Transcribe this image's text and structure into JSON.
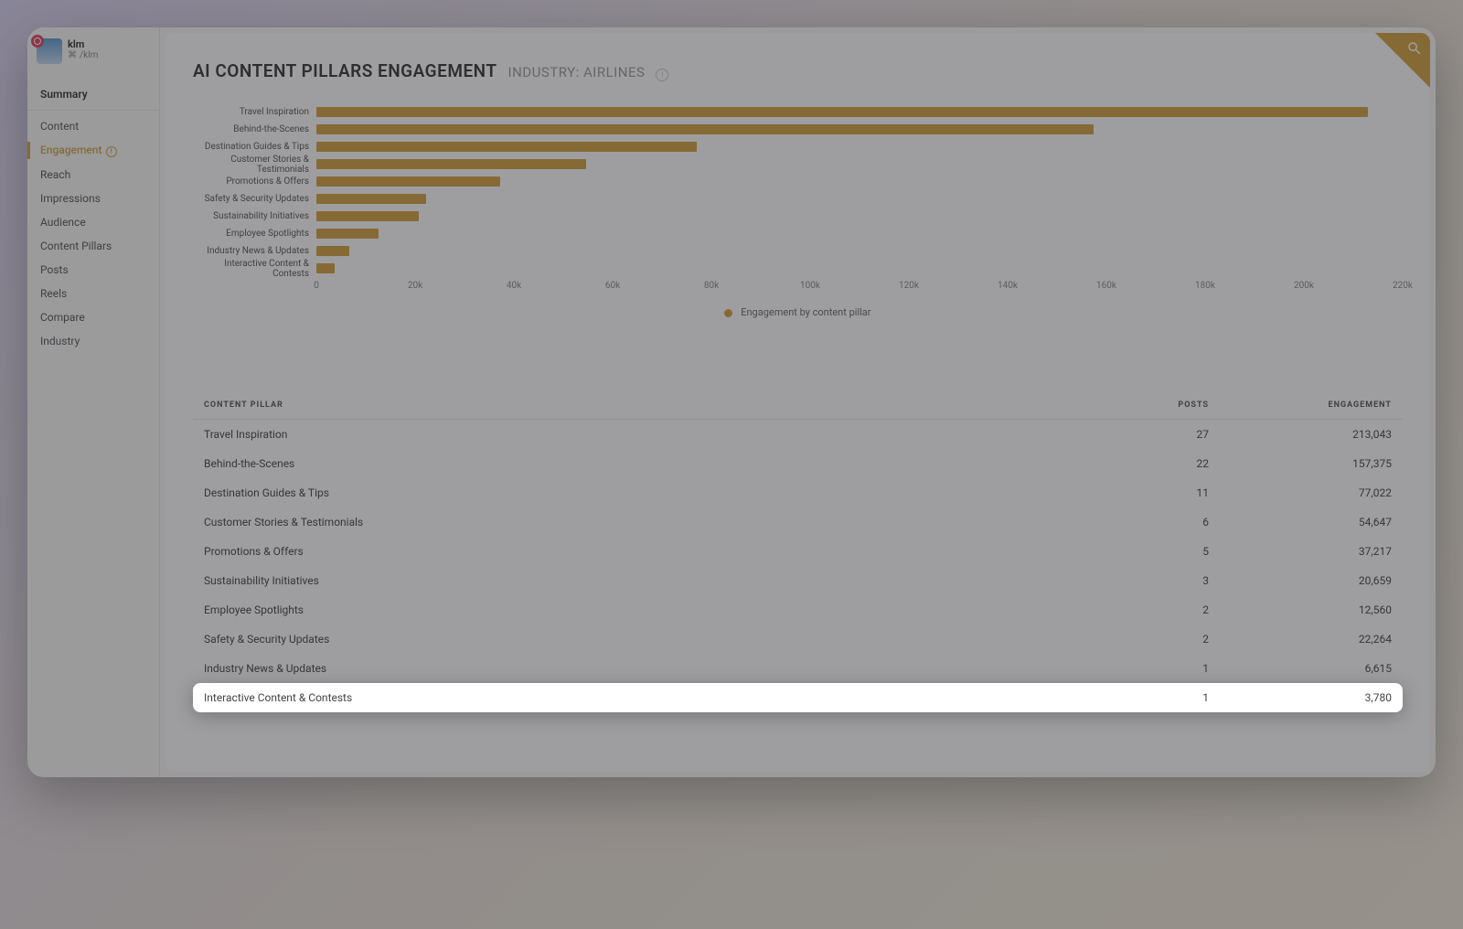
{
  "profile": {
    "name": "klm",
    "handle": "/klm"
  },
  "sidebar": {
    "summary": "Summary",
    "items": [
      {
        "label": "Content"
      },
      {
        "label": "Engagement",
        "active": true,
        "info": true
      },
      {
        "label": "Reach"
      },
      {
        "label": "Impressions"
      },
      {
        "label": "Audience"
      },
      {
        "label": "Content Pillars"
      },
      {
        "label": "Posts"
      },
      {
        "label": "Reels"
      },
      {
        "label": "Compare"
      },
      {
        "label": "Industry"
      }
    ]
  },
  "header": {
    "title": "AI CONTENT PILLARS ENGAGEMENT",
    "subtitle": "INDUSTRY: AIRLINES"
  },
  "chart_data": {
    "type": "bar",
    "orientation": "horizontal",
    "title": "AI CONTENT PILLARS ENGAGEMENT",
    "xlabel": "",
    "ylabel": "",
    "legend": "Engagement by content pillar",
    "xlim": [
      0,
      220000
    ],
    "x_ticks": [
      "0",
      "20k",
      "40k",
      "60k",
      "80k",
      "100k",
      "120k",
      "140k",
      "160k",
      "180k",
      "200k",
      "220k"
    ],
    "categories": [
      "Travel Inspiration",
      "Behind-the-Scenes",
      "Destination Guides & Tips",
      "Customer Stories & Testimonials",
      "Promotions & Offers",
      "Safety & Security Updates",
      "Sustainability Initiatives",
      "Employee Spotlights",
      "Industry News & Updates",
      "Interactive Content & Contests"
    ],
    "values": [
      213043,
      157375,
      77022,
      54647,
      37217,
      22264,
      20659,
      12560,
      6615,
      3780
    ],
    "bar_color": "#d4a03e"
  },
  "table": {
    "headers": {
      "pillar": "CONTENT PILLAR",
      "posts": "POSTS",
      "eng": "ENGAGEMENT"
    },
    "rows": [
      {
        "pillar": "Travel Inspiration",
        "posts": "27",
        "eng": "213,043"
      },
      {
        "pillar": "Behind-the-Scenes",
        "posts": "22",
        "eng": "157,375"
      },
      {
        "pillar": "Destination Guides & Tips",
        "posts": "11",
        "eng": "77,022"
      },
      {
        "pillar": "Customer Stories & Testimonials",
        "posts": "6",
        "eng": "54,647"
      },
      {
        "pillar": "Promotions & Offers",
        "posts": "5",
        "eng": "37,217"
      },
      {
        "pillar": "Sustainability Initiatives",
        "posts": "3",
        "eng": "20,659"
      },
      {
        "pillar": "Employee Spotlights",
        "posts": "2",
        "eng": "12,560"
      },
      {
        "pillar": "Safety & Security Updates",
        "posts": "2",
        "eng": "22,264"
      },
      {
        "pillar": "Industry News & Updates",
        "posts": "1",
        "eng": "6,615"
      },
      {
        "pillar": "Interactive Content & Contests",
        "posts": "1",
        "eng": "3,780",
        "highlight": true
      }
    ]
  }
}
